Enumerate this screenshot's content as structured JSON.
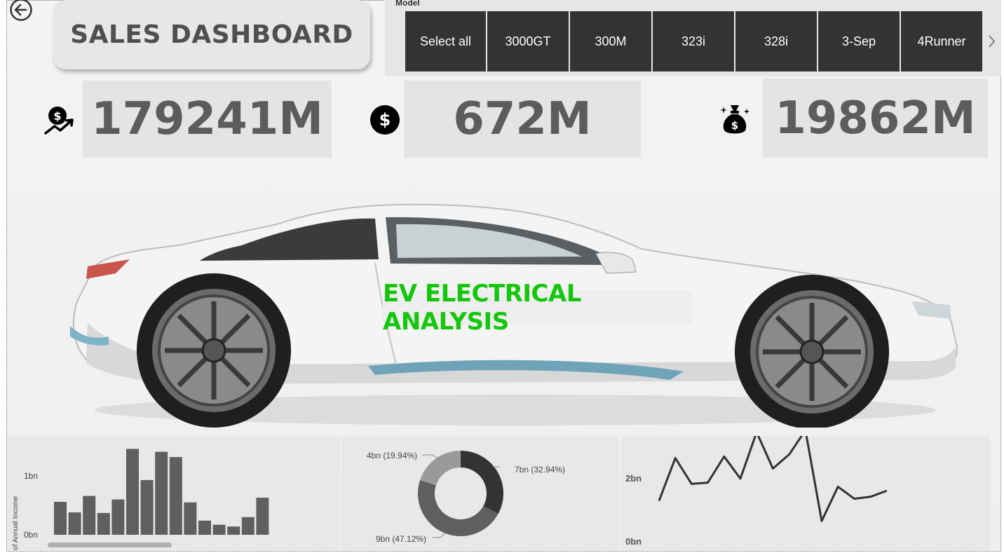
{
  "dashboard": {
    "title": "SALES DASHBOARD",
    "banner_text": "EV ELECTRICAL ANALYSIS"
  },
  "slicer": {
    "label": "Model",
    "options": [
      "Select all",
      "3000GT",
      "300M",
      "323i",
      "328i",
      "3-Sep",
      "4Runner"
    ]
  },
  "kpis": [
    {
      "value": "179241M",
      "icon": "revenue-growth-icon"
    },
    {
      "value": "672M",
      "icon": "dollar-coin-icon"
    },
    {
      "value": "19862M",
      "icon": "money-bag-icon"
    }
  ],
  "colors": {
    "tile_bg": "#333333",
    "kpi_text": "#5c5c5c",
    "banner_green": "#16c60c",
    "bar": "#5f5f5f",
    "line": "#333333"
  },
  "chart_data": [
    {
      "type": "bar",
      "ylabel": "Sum of Annual Income",
      "yticks": [
        "0bn",
        "1bn"
      ],
      "ylim": [
        0,
        1.5
      ],
      "values": [
        0.56,
        0.38,
        0.66,
        0.37,
        0.6,
        1.46,
        0.93,
        1.41,
        1.32,
        0.55,
        0.24,
        0.17,
        0.14,
        0.3,
        0.63
      ]
    },
    {
      "type": "pie",
      "donut": true,
      "slices": [
        {
          "label": "7bn (32.94%)",
          "value": 32.94,
          "color": "#333333"
        },
        {
          "label": "9bn (47.12%)",
          "value": 47.12,
          "color": "#5f5f5f"
        },
        {
          "label": "4bn (19.94%)",
          "value": 19.94,
          "color": "#9a9a9a"
        }
      ]
    },
    {
      "type": "line",
      "yticks": [
        "0bn",
        "2bn"
      ],
      "ylim": [
        0,
        2.4
      ],
      "values": [
        1.0,
        2.06,
        1.42,
        1.45,
        2.1,
        1.55,
        2.7,
        1.8,
        2.15,
        2.75,
        0.5,
        1.35,
        1.05,
        1.1,
        1.25
      ]
    }
  ]
}
